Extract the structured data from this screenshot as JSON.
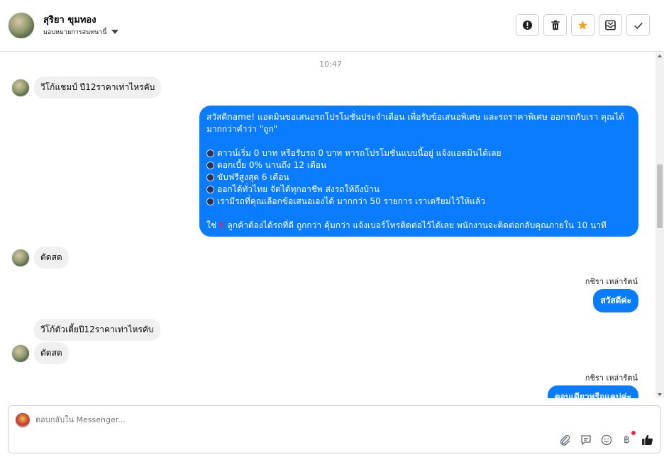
{
  "header": {
    "contact_name": "สุริยา ขุมทอง",
    "assign_label": "มอบหมายการสนทนานี้"
  },
  "actions": [
    {
      "name": "spam-button",
      "icon": "alert-icon"
    },
    {
      "name": "delete-button",
      "icon": "trash-icon"
    },
    {
      "name": "star-button",
      "icon": "star-icon",
      "color": "#f7a21b"
    },
    {
      "name": "archive-button",
      "icon": "envelope-archive-icon"
    },
    {
      "name": "mark-done-button",
      "icon": "check-icon"
    }
  ],
  "chat": {
    "timestamp": "10:47",
    "msg1": "วีโก้แชมป์ ปี12ราคาเท่าไหรคับ",
    "bot": {
      "intro1": "สวัสดีname! แอดมินขอเสนอรถโปรโมชั่นประจำเดือน เพื่อรับข้อเสนอพิเศษ และรถราคาพิเศษ ออกรถกับเรา คุณได้",
      "intro2": "มากกว่าคำว่า \"ถูก\"",
      "b1": "ดาวน์เริ่ม 0 บาท หรือรับรถ 0 บาท หารถโปรโมชั่นแบบนี้อยู่ แจ้งแอดมินได้เลย",
      "b2": "ดอกเบี้ย 0% นานถึง 12 เดือน",
      "b3": "ขับฟรีสูงสุด 6 เดือน",
      "b4": "ออกได้ทั่วไทย จัดได้ทุกอาชีพ ส่งรถให้ถึงบ้าน",
      "b5": "เรามีรถที่คุณเลือกข้อเสนอเองได้ มากกว่า 50 รายการ เราเตรียมไว้ให้แล้ว",
      "closing_pre": "ใช่",
      "closing_post": "ลูกค้าต้องได้รถที่ดี ถูกกว่า คุ้มกว่า แจ้งเบอร์โทรติดต่อไว้ได้เลย พนักงานจะติดต่อกลับคุณภายใน 10 นาที"
    },
    "msg3": "ตัดสด",
    "agent_name": "กชิรา เหล่ารัตน์",
    "msg4": "สวัสดีค่ะ",
    "msg5": "วีโก้ตัวเตี้ยปี12ราคาเท่าไหรคับ",
    "msg6": "ตัดสด",
    "agent_name2": "กชิรา เหล่ารัตน์",
    "msg7": "ตอนเดียวหรือแคปค่ะ"
  },
  "composer": {
    "placeholder": "ตอบกลับใน Messenger...",
    "tools": [
      "attach-icon",
      "saved-reply-icon",
      "emoji-icon",
      "payment-icon",
      "like-icon"
    ]
  },
  "colors": {
    "outgoing_bubble": "#0a7cff",
    "incoming_bubble": "#f0f0f0",
    "like": "#1c1e21"
  }
}
